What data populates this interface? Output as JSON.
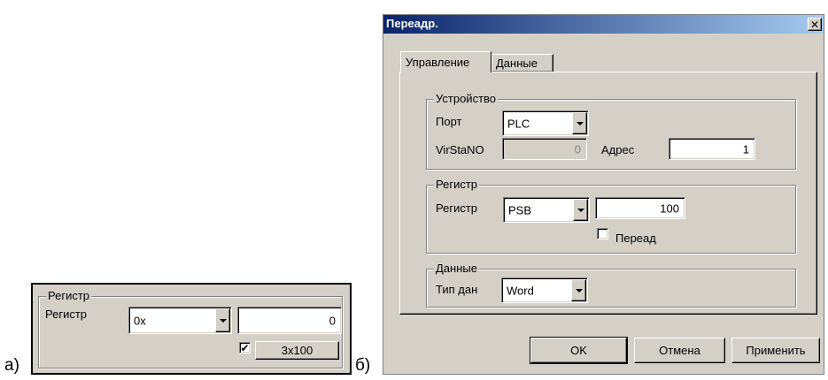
{
  "labels": {
    "a": "а)",
    "b": "б)"
  },
  "panel_a": {
    "group_title": "Регистр",
    "register_label": "Регистр",
    "register_value": "0x",
    "address_value": "0",
    "checkbox_checked": true,
    "button_label": "3x100"
  },
  "dialog": {
    "title": "Переадр.",
    "tabs": [
      "Управление",
      "Данные"
    ],
    "active_tab": "Управление",
    "device": {
      "group_title": "Устройство",
      "port_label": "Порт",
      "port_value": "PLC",
      "virstano_label": "VirStaNO",
      "virstano_value": "0",
      "address_label": "Адрес",
      "address_value": "1"
    },
    "register": {
      "group_title": "Регистр",
      "register_label": "Регистр",
      "register_value": "PSB",
      "address_value": "100",
      "redirect_label": "Переад",
      "redirect_checked": false
    },
    "data": {
      "group_title": "Данные",
      "type_label": "Тип дан",
      "type_value": "Word"
    },
    "buttons": {
      "ok": "OK",
      "cancel": "Отмена",
      "apply": "Применить"
    }
  },
  "colors": {
    "face": "#d4d0c8",
    "title_gradient_start": "#0a246a",
    "title_gradient_end": "#a6caf0"
  }
}
